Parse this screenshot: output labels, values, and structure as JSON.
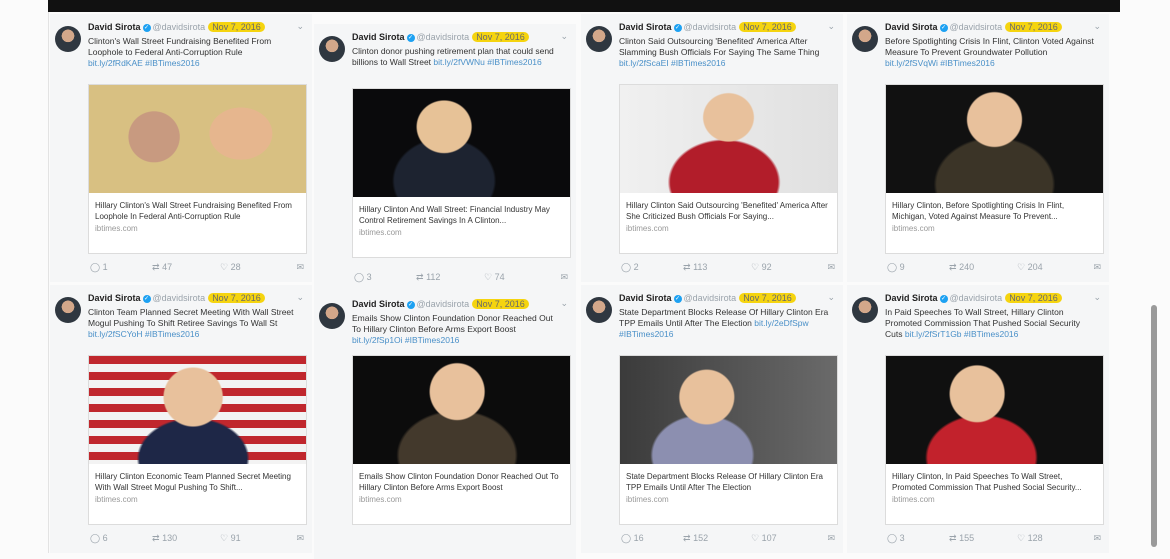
{
  "tweets": [
    {
      "author": "David Sirota",
      "handle": "@davidsirota",
      "date": "Nov 7, 2016",
      "text": "Clinton's Wall Street Fundraising Benefited From Loophole to Federal Anti-Corruption Rule ",
      "link": "bit.ly/2fRdKAE #IBTimes2016",
      "card_title": "Hillary Clinton's Wall Street Fundraising Benefited From Loophole In Federal Anti-Corruption Rule",
      "card_domain": "ibtimes.com",
      "reply": "1",
      "retweets": "47",
      "likes": "28"
    },
    {
      "author": "David Sirota",
      "handle": "@davidsirota",
      "date": "Nov 7, 2016",
      "text": "Clinton donor pushing retirement plan that could send billions to Wall Street ",
      "link": "bit.ly/2fVWNu #IBTimes2016",
      "card_title": "Hillary Clinton And Wall Street: Financial Industry May Control Retirement Savings In A Clinton...",
      "card_domain": "ibtimes.com",
      "reply": "3",
      "retweets": "112",
      "likes": "74"
    },
    {
      "author": "David Sirota",
      "handle": "@davidsirota",
      "date": "Nov 7, 2016",
      "text": "Clinton Said Outsourcing 'Benefited' America After Slamming Bush Officials For Saying The Same Thing ",
      "link": "bit.ly/2fScaEI #IBTimes2016",
      "card_title": "Hillary Clinton Said Outsourcing 'Benefited' America After She Criticized Bush Officials For Saying...",
      "card_domain": "ibtimes.com",
      "reply": "2",
      "retweets": "113",
      "likes": "92"
    },
    {
      "author": "David Sirota",
      "handle": "@davidsirota",
      "date": "Nov 7, 2016",
      "text": "Before Spotlighting Crisis In Flint, Clinton Voted Against Measure To Prevent Groundwater Pollution ",
      "link": "bit.ly/2fSVqWi #IBTimes2016",
      "card_title": "Hillary Clinton, Before Spotlighting Crisis In Flint, Michigan, Voted Against Measure To Prevent...",
      "card_domain": "ibtimes.com",
      "reply": "9",
      "retweets": "240",
      "likes": "204"
    },
    {
      "author": "David Sirota",
      "handle": "@davidsirota",
      "date": "Nov 7, 2016",
      "text": "Clinton Team Planned Secret Meeting With Wall Street Mogul Pushing To Shift Retiree Savings To Wall St ",
      "link": "bit.ly/2fSCYoH #IBTimes2016",
      "card_title": "Hillary Clinton Economic Team Planned Secret Meeting With Wall Street Mogul Pushing To Shift...",
      "card_domain": "ibtimes.com",
      "reply": "6",
      "retweets": "130",
      "likes": "91"
    },
    {
      "author": "David Sirota",
      "handle": "@davidsirota",
      "date": "Nov 7, 2016",
      "text": "Emails Show Clinton Foundation Donor Reached Out To Hillary Clinton Before Arms Export Boost ",
      "link": "bit.ly/2fSp1Oi #IBTimes2016",
      "card_title": "Emails Show Clinton Foundation Donor Reached Out To Hillary Clinton Before Arms Export Boost",
      "card_domain": "ibtimes.com",
      "reply": "",
      "retweets": "",
      "likes": ""
    },
    {
      "author": "David Sirota",
      "handle": "@davidsirota",
      "date": "Nov 7, 2016",
      "text": "State Department Blocks Release Of Hillary Clinton Era TPP Emails Until After The Election ",
      "link": "bit.ly/2eDfSpw #IBTimes2016",
      "card_title": "State Department Blocks Release Of Hillary Clinton Era TPP Emails Until After The Election",
      "card_domain": "ibtimes.com",
      "reply": "16",
      "retweets": "152",
      "likes": "107"
    },
    {
      "author": "David Sirota",
      "handle": "@davidsirota",
      "date": "Nov 7, 2016",
      "text": "In Paid Speeches To Wall Street, Hillary Clinton Promoted Commission That Pushed Social Security Cuts ",
      "link": "bit.ly/2fSrT1Gb #IBTimes2016",
      "card_title": "Hillary Clinton, In Paid Speeches To Wall Street, Promoted Commission That Pushed Social Security...",
      "card_domain": "ibtimes.com",
      "reply": "3",
      "retweets": "155",
      "likes": "128"
    }
  ]
}
